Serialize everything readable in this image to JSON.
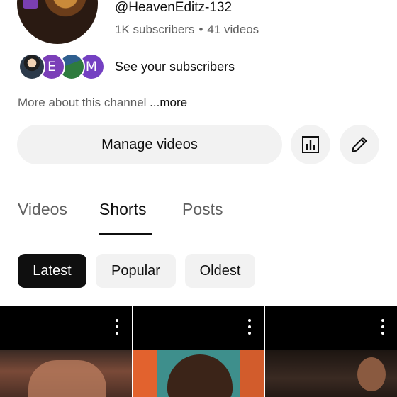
{
  "channel": {
    "handle": "@HeavenEditz-132",
    "subscribers": "1K subscribers",
    "separator": "•",
    "videos": "41 videos",
    "avatar_icon": "channel-avatar"
  },
  "subscribers_row": {
    "avatars": [
      {
        "letter": "",
        "color": "#2c3a4a"
      },
      {
        "letter": "E",
        "color": "#7b3fb8"
      },
      {
        "letter": "",
        "color": "#2e7b3e"
      },
      {
        "letter": "M",
        "color": "#7440c2"
      }
    ],
    "label": "See your subscribers"
  },
  "about": {
    "text": "More about this channel ",
    "more": "...more"
  },
  "actions": {
    "manage_label": "Manage videos",
    "analytics_icon": "analytics-icon",
    "edit_icon": "pencil-icon"
  },
  "tabs": [
    {
      "label": "Videos",
      "selected": false
    },
    {
      "label": "Shorts",
      "selected": true
    },
    {
      "label": "Posts",
      "selected": false
    }
  ],
  "chips": [
    {
      "label": "Latest",
      "selected": true
    },
    {
      "label": "Popular",
      "selected": false
    },
    {
      "label": "Oldest",
      "selected": false
    }
  ],
  "shorts": [
    {
      "menu_icon": "more-vert-icon"
    },
    {
      "menu_icon": "more-vert-icon"
    },
    {
      "menu_icon": "more-vert-icon"
    }
  ],
  "colors": {
    "text_primary": "#0f0f0f",
    "text_secondary": "#606060",
    "chip_bg": "#f2f2f2",
    "chip_selected_bg": "#0f0f0f"
  }
}
